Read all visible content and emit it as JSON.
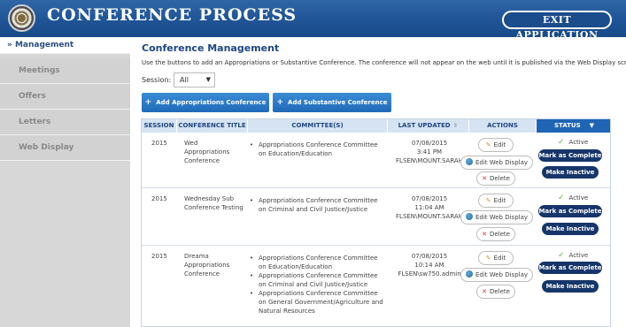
{
  "header": {
    "title": "CONFERENCE PROCESS",
    "exit_label": "EXIT APPLICATION"
  },
  "sidebar": {
    "items": [
      {
        "label": "» Management"
      },
      {
        "label": "Meetings"
      },
      {
        "label": "Offers"
      },
      {
        "label": "Letters"
      },
      {
        "label": "Web Display"
      }
    ]
  },
  "main": {
    "title": "Conference Management",
    "description": "Use the buttons to add an Appropriations or Substantive Conference. The conference will not appear on the web until it is published via the Web Display screen.",
    "session_label": "Session:",
    "session_value": "All",
    "add_appropriations": "Add Appropriations Conference",
    "add_substantive": "Add Substantive Conference"
  },
  "table": {
    "headers": [
      "SESSION",
      "CONFERENCE TITLE",
      "COMMITTEE(S)",
      "LAST UPDATED",
      "ACTIONS",
      "STATUS"
    ],
    "action_labels": {
      "edit": "Edit",
      "edit_web": "Edit Web Display",
      "delete": "Delete"
    },
    "status_buttons": {
      "complete": "Mark as Complete",
      "inactive": "Make Inactive"
    },
    "rows": [
      {
        "session": "2015",
        "title": "Wed Appropriations Conference",
        "committees": [
          "Appropriations Conference Committee on Education/Education"
        ],
        "date": "07/08/2015",
        "time": "3:41 PM",
        "user": "FLSEN\\MOUNT.SARAH",
        "status": "Active"
      },
      {
        "session": "2015",
        "title": "Wednesday Sub Conference Testing",
        "committees": [
          "Appropriations Conference Committee on Criminal and Civil Justice/Justice"
        ],
        "date": "07/08/2015",
        "time": "11:04 AM",
        "user": "FLSEN\\MOUNT.SARAH",
        "status": "Active"
      },
      {
        "session": "2015",
        "title": "Dreama Appropriations Conference",
        "committees": [
          "Appropriations Conference Committee on Education/Education",
          "Appropriations Conference Committee on Criminal and Civil Justice/Justice",
          "Appropriations Conference Committee on General Government/Agriculture and Natural Resources"
        ],
        "date": "07/08/2015",
        "time": "10:14 AM",
        "user": "FLSEN\\sw750.admin",
        "status": "Active"
      }
    ]
  }
}
